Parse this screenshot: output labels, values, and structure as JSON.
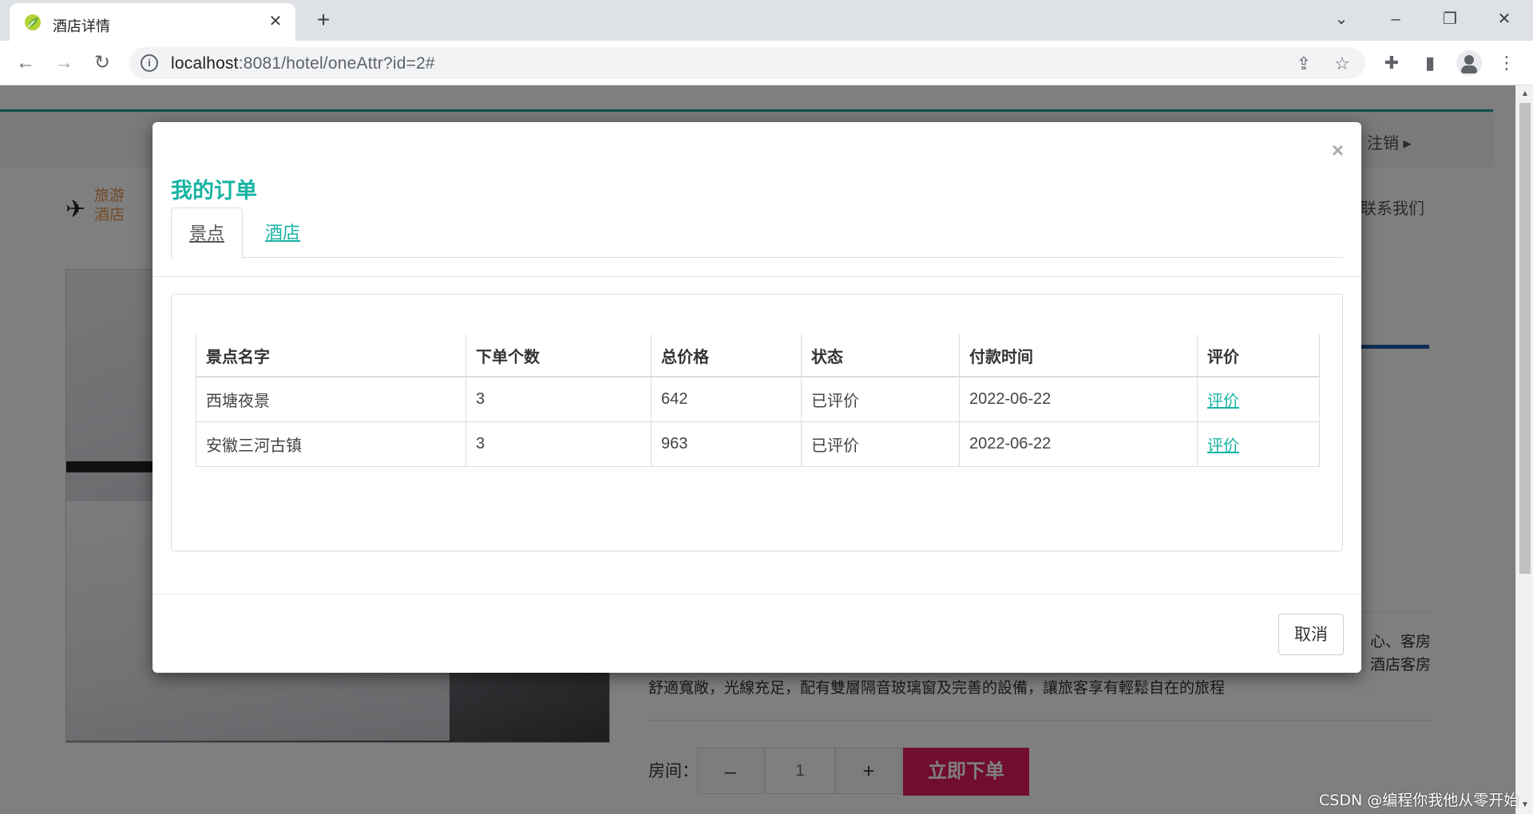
{
  "browser": {
    "tab_title": "酒店详情",
    "url_host": "localhost",
    "url_rest": ":8081/hotel/oneAttr?id=2#"
  },
  "page": {
    "logout": "注销",
    "logo_line1": "旅游",
    "logo_line2": "酒店",
    "contact": "联系我们",
    "description_fragment_1": "心、客房",
    "description_fragment_2": "酒店客房",
    "description_line_3": "舒適寬敞，光線充足，配有雙層隔音玻璃窗及完善的設備，讓旅客享有輕鬆自在的旅程",
    "room_label": "房间：",
    "minus": "–",
    "plus": "+",
    "quantity": "1",
    "order_button": "立即下单"
  },
  "modal": {
    "title": "我的订单",
    "tabs": [
      {
        "label": "景点",
        "active": true
      },
      {
        "label": "酒店",
        "active": false
      }
    ],
    "table": {
      "headers": [
        "景点名字",
        "下单个数",
        "总价格",
        "状态",
        "付款时间",
        "评价"
      ],
      "rows": [
        {
          "name": "西塘夜景",
          "count": "3",
          "price": "642",
          "status": "已评价",
          "paid_time": "2022-06-22",
          "review_link": "评价"
        },
        {
          "name": "安徽三河古镇",
          "count": "3",
          "price": "963",
          "status": "已评价",
          "paid_time": "2022-06-22",
          "review_link": "评价"
        }
      ]
    },
    "cancel_button": "取消",
    "close_symbol": "×"
  },
  "watermark": "CSDN @编程你我他从零开始",
  "colors": {
    "accent": "#17b3a3",
    "order_button": "#e21b5d",
    "logo": "#e8944a"
  }
}
